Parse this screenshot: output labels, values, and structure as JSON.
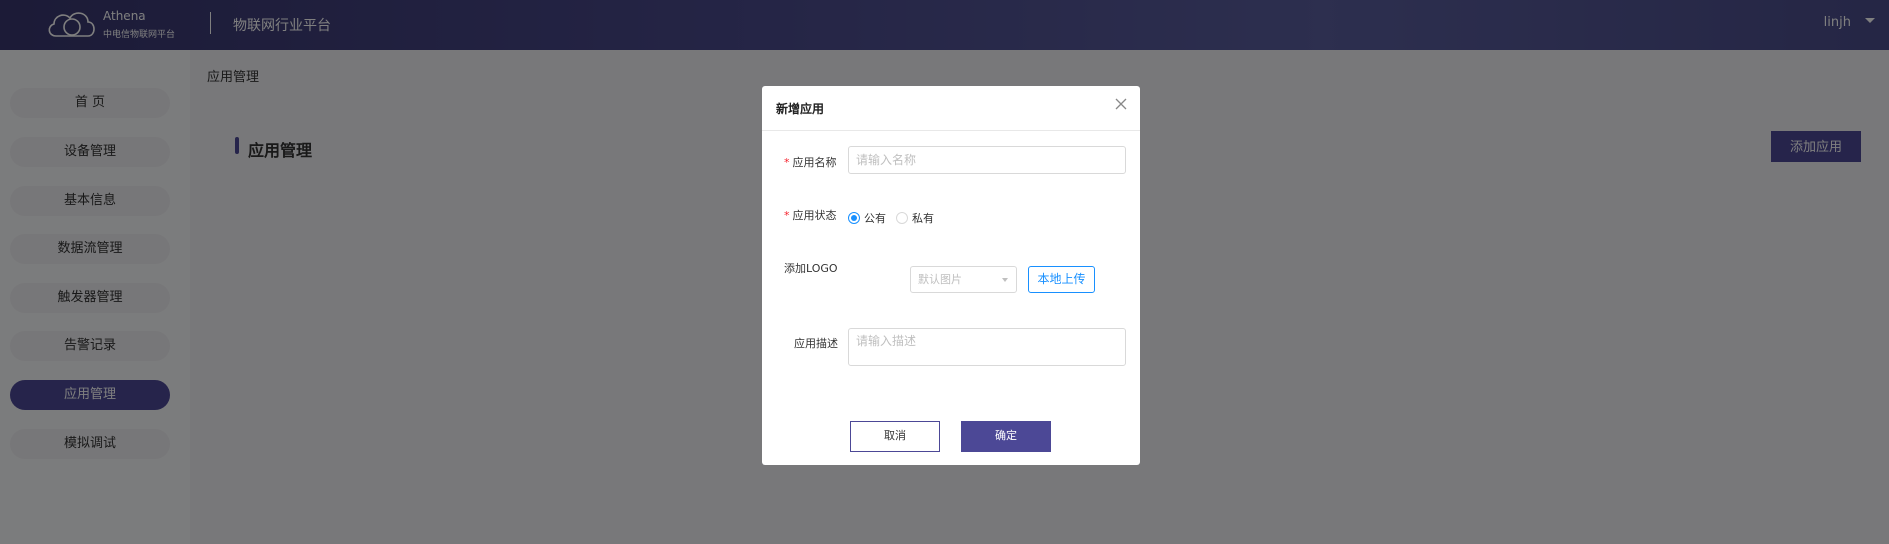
{
  "header": {
    "brand_name": "Athena",
    "brand_sub": "中电信物联网平台",
    "platform_title": "物联网行业平台",
    "user": "linjh"
  },
  "sidebar": {
    "items": [
      {
        "label": "首 页"
      },
      {
        "label": "设备管理"
      },
      {
        "label": "基本信息"
      },
      {
        "label": "数据流管理"
      },
      {
        "label": "触发器管理"
      },
      {
        "label": "告警记录"
      },
      {
        "label": "应用管理",
        "active": true
      },
      {
        "label": "模拟调试"
      }
    ]
  },
  "main": {
    "breadcrumb": "应用管理",
    "section_title": "应用管理",
    "add_button": "添加应用"
  },
  "dialog": {
    "title": "新增应用",
    "name_label": "应用名称",
    "name_placeholder": "请输入名称",
    "name_value": "",
    "status_label": "应用状态",
    "status_options": [
      "公有",
      "私有"
    ],
    "status_selected": "公有",
    "logo_label": "添加LOGO",
    "logo_select_value": "默认图片",
    "upload_button": "本地上传",
    "desc_label": "应用描述",
    "desc_placeholder": "请输入描述",
    "desc_value": "",
    "cancel_button": "取消",
    "ok_button": "确定"
  },
  "colors": {
    "accent": "#4c4896",
    "link": "#1890ff",
    "required": "#f5222d"
  }
}
